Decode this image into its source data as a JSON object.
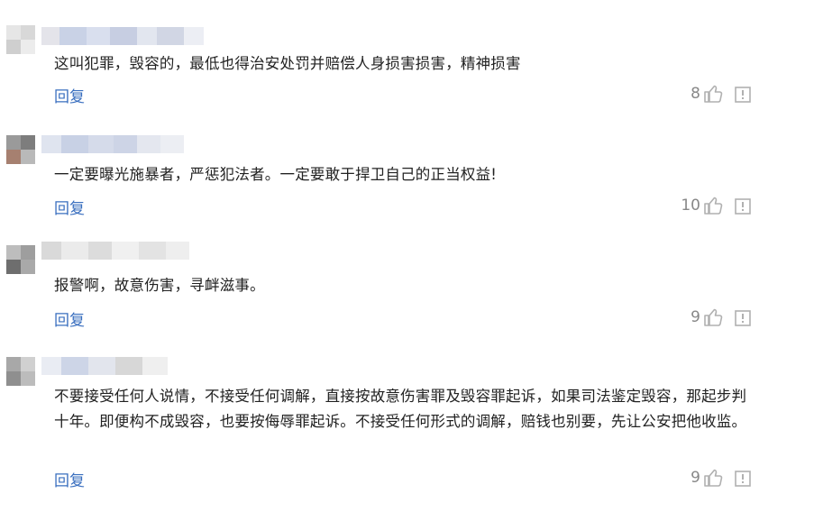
{
  "comments": [
    {
      "text": "这叫犯罪，毁容的，最低也得治安处罚并赔偿人身损害损害，精神损害",
      "reply_label": "回复",
      "likes": "8",
      "icons": {
        "like": "thumbs-up-icon",
        "report": "report-icon"
      }
    },
    {
      "text": "一定要曝光施暴者，严惩犯法者。一定要敢于捍卫自己的正当权益!",
      "reply_label": "回复",
      "likes": "10",
      "icons": {
        "like": "thumbs-up-icon",
        "report": "report-icon"
      }
    },
    {
      "text": "报警啊，故意伤害，寻衅滋事。",
      "reply_label": "回复",
      "likes": "9",
      "icons": {
        "like": "thumbs-up-icon",
        "report": "report-icon"
      }
    },
    {
      "text": "不要接受任何人说情，不接受任何调解，直接按故意伤害罪及毁容罪起诉，如果司法鉴定毁容，那起步判十年。即便构不成毁容，也要按侮辱罪起诉。不接受任何形式的调解，赔钱也别要，先让公安把他收监。",
      "reply_label": "回复",
      "likes": "9",
      "icons": {
        "like": "thumbs-up-icon",
        "report": "report-icon"
      }
    }
  ],
  "colors": {
    "reply_link": "#3a6fbf",
    "body_text": "#222222",
    "muted": "#888888",
    "icon_gray": "#b0b0b0"
  }
}
